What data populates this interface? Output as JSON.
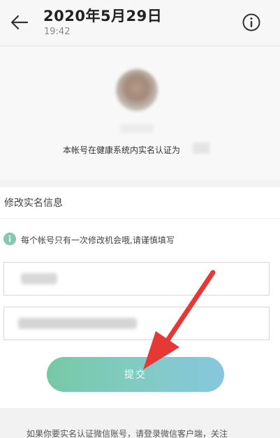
{
  "header": {
    "title": "2020年5月29日",
    "subtitle": "19:42",
    "back_icon": "arrow-left-icon",
    "info_icon": "info-circle-icon"
  },
  "profile": {
    "verified_text": "本帐号在健康系统内实名认证为"
  },
  "edit_section": {
    "title": "修改实名信息",
    "notice": "每个帐号只有一次修改机会哦,请谨慎填写",
    "notice_icon": "info-icon"
  },
  "form": {
    "submit_label": "提交"
  },
  "footer": {
    "text": "如果你要实名认证微信账号，请登录微信客户端，关注"
  },
  "colors": {
    "accent_start": "#76c9a6",
    "accent_end": "#86c7de",
    "annotation_arrow": "#e53935"
  }
}
